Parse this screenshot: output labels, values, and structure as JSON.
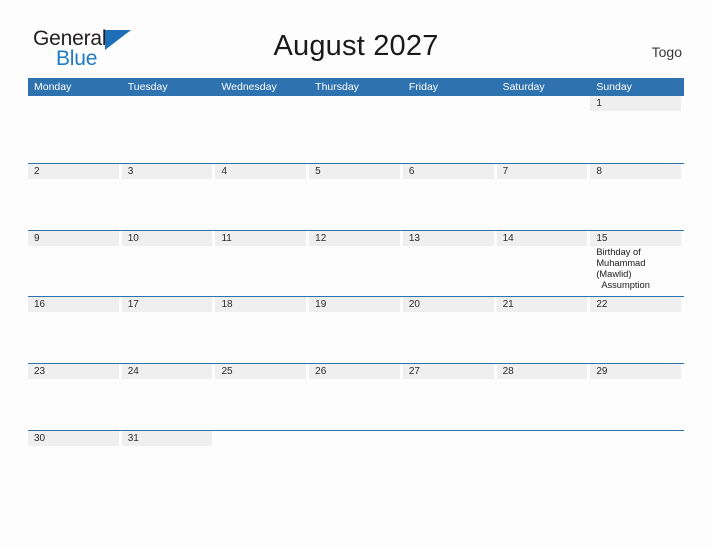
{
  "brand": {
    "name_part1": "General",
    "name_part2": "Blue",
    "triangle_icon": "triangle-logo-icon",
    "color_dark": "#231f20",
    "color_blue": "#1f7ac4"
  },
  "header": {
    "title": "August 2027",
    "country": "Togo"
  },
  "theme": {
    "header_blue": "#2e72b0",
    "date_band_gray": "#efefef",
    "page_background": "#fdfdfd",
    "text_color": "#1a1a1a"
  },
  "calendar": {
    "month": "August",
    "year": "2027",
    "weekday_headers": [
      "Monday",
      "Tuesday",
      "Wednesday",
      "Thursday",
      "Friday",
      "Saturday",
      "Sunday"
    ],
    "weeks": [
      [
        {
          "date": "",
          "events": []
        },
        {
          "date": "",
          "events": []
        },
        {
          "date": "",
          "events": []
        },
        {
          "date": "",
          "events": []
        },
        {
          "date": "",
          "events": []
        },
        {
          "date": "",
          "events": []
        },
        {
          "date": "1",
          "events": []
        }
      ],
      [
        {
          "date": "2",
          "events": []
        },
        {
          "date": "3",
          "events": []
        },
        {
          "date": "4",
          "events": []
        },
        {
          "date": "5",
          "events": []
        },
        {
          "date": "6",
          "events": []
        },
        {
          "date": "7",
          "events": []
        },
        {
          "date": "8",
          "events": []
        }
      ],
      [
        {
          "date": "9",
          "events": []
        },
        {
          "date": "10",
          "events": []
        },
        {
          "date": "11",
          "events": []
        },
        {
          "date": "12",
          "events": []
        },
        {
          "date": "13",
          "events": []
        },
        {
          "date": "14",
          "events": []
        },
        {
          "date": "15",
          "events": [
            "Birthday of Muhammad (Mawlid)",
            "Assumption"
          ]
        }
      ],
      [
        {
          "date": "16",
          "events": []
        },
        {
          "date": "17",
          "events": []
        },
        {
          "date": "18",
          "events": []
        },
        {
          "date": "19",
          "events": []
        },
        {
          "date": "20",
          "events": []
        },
        {
          "date": "21",
          "events": []
        },
        {
          "date": "22",
          "events": []
        }
      ],
      [
        {
          "date": "23",
          "events": []
        },
        {
          "date": "24",
          "events": []
        },
        {
          "date": "25",
          "events": []
        },
        {
          "date": "26",
          "events": []
        },
        {
          "date": "27",
          "events": []
        },
        {
          "date": "28",
          "events": []
        },
        {
          "date": "29",
          "events": []
        }
      ],
      [
        {
          "date": "30",
          "events": []
        },
        {
          "date": "31",
          "events": []
        },
        {
          "date": "",
          "events": []
        },
        {
          "date": "",
          "events": []
        },
        {
          "date": "",
          "events": []
        },
        {
          "date": "",
          "events": []
        },
        {
          "date": "",
          "events": []
        }
      ]
    ]
  }
}
